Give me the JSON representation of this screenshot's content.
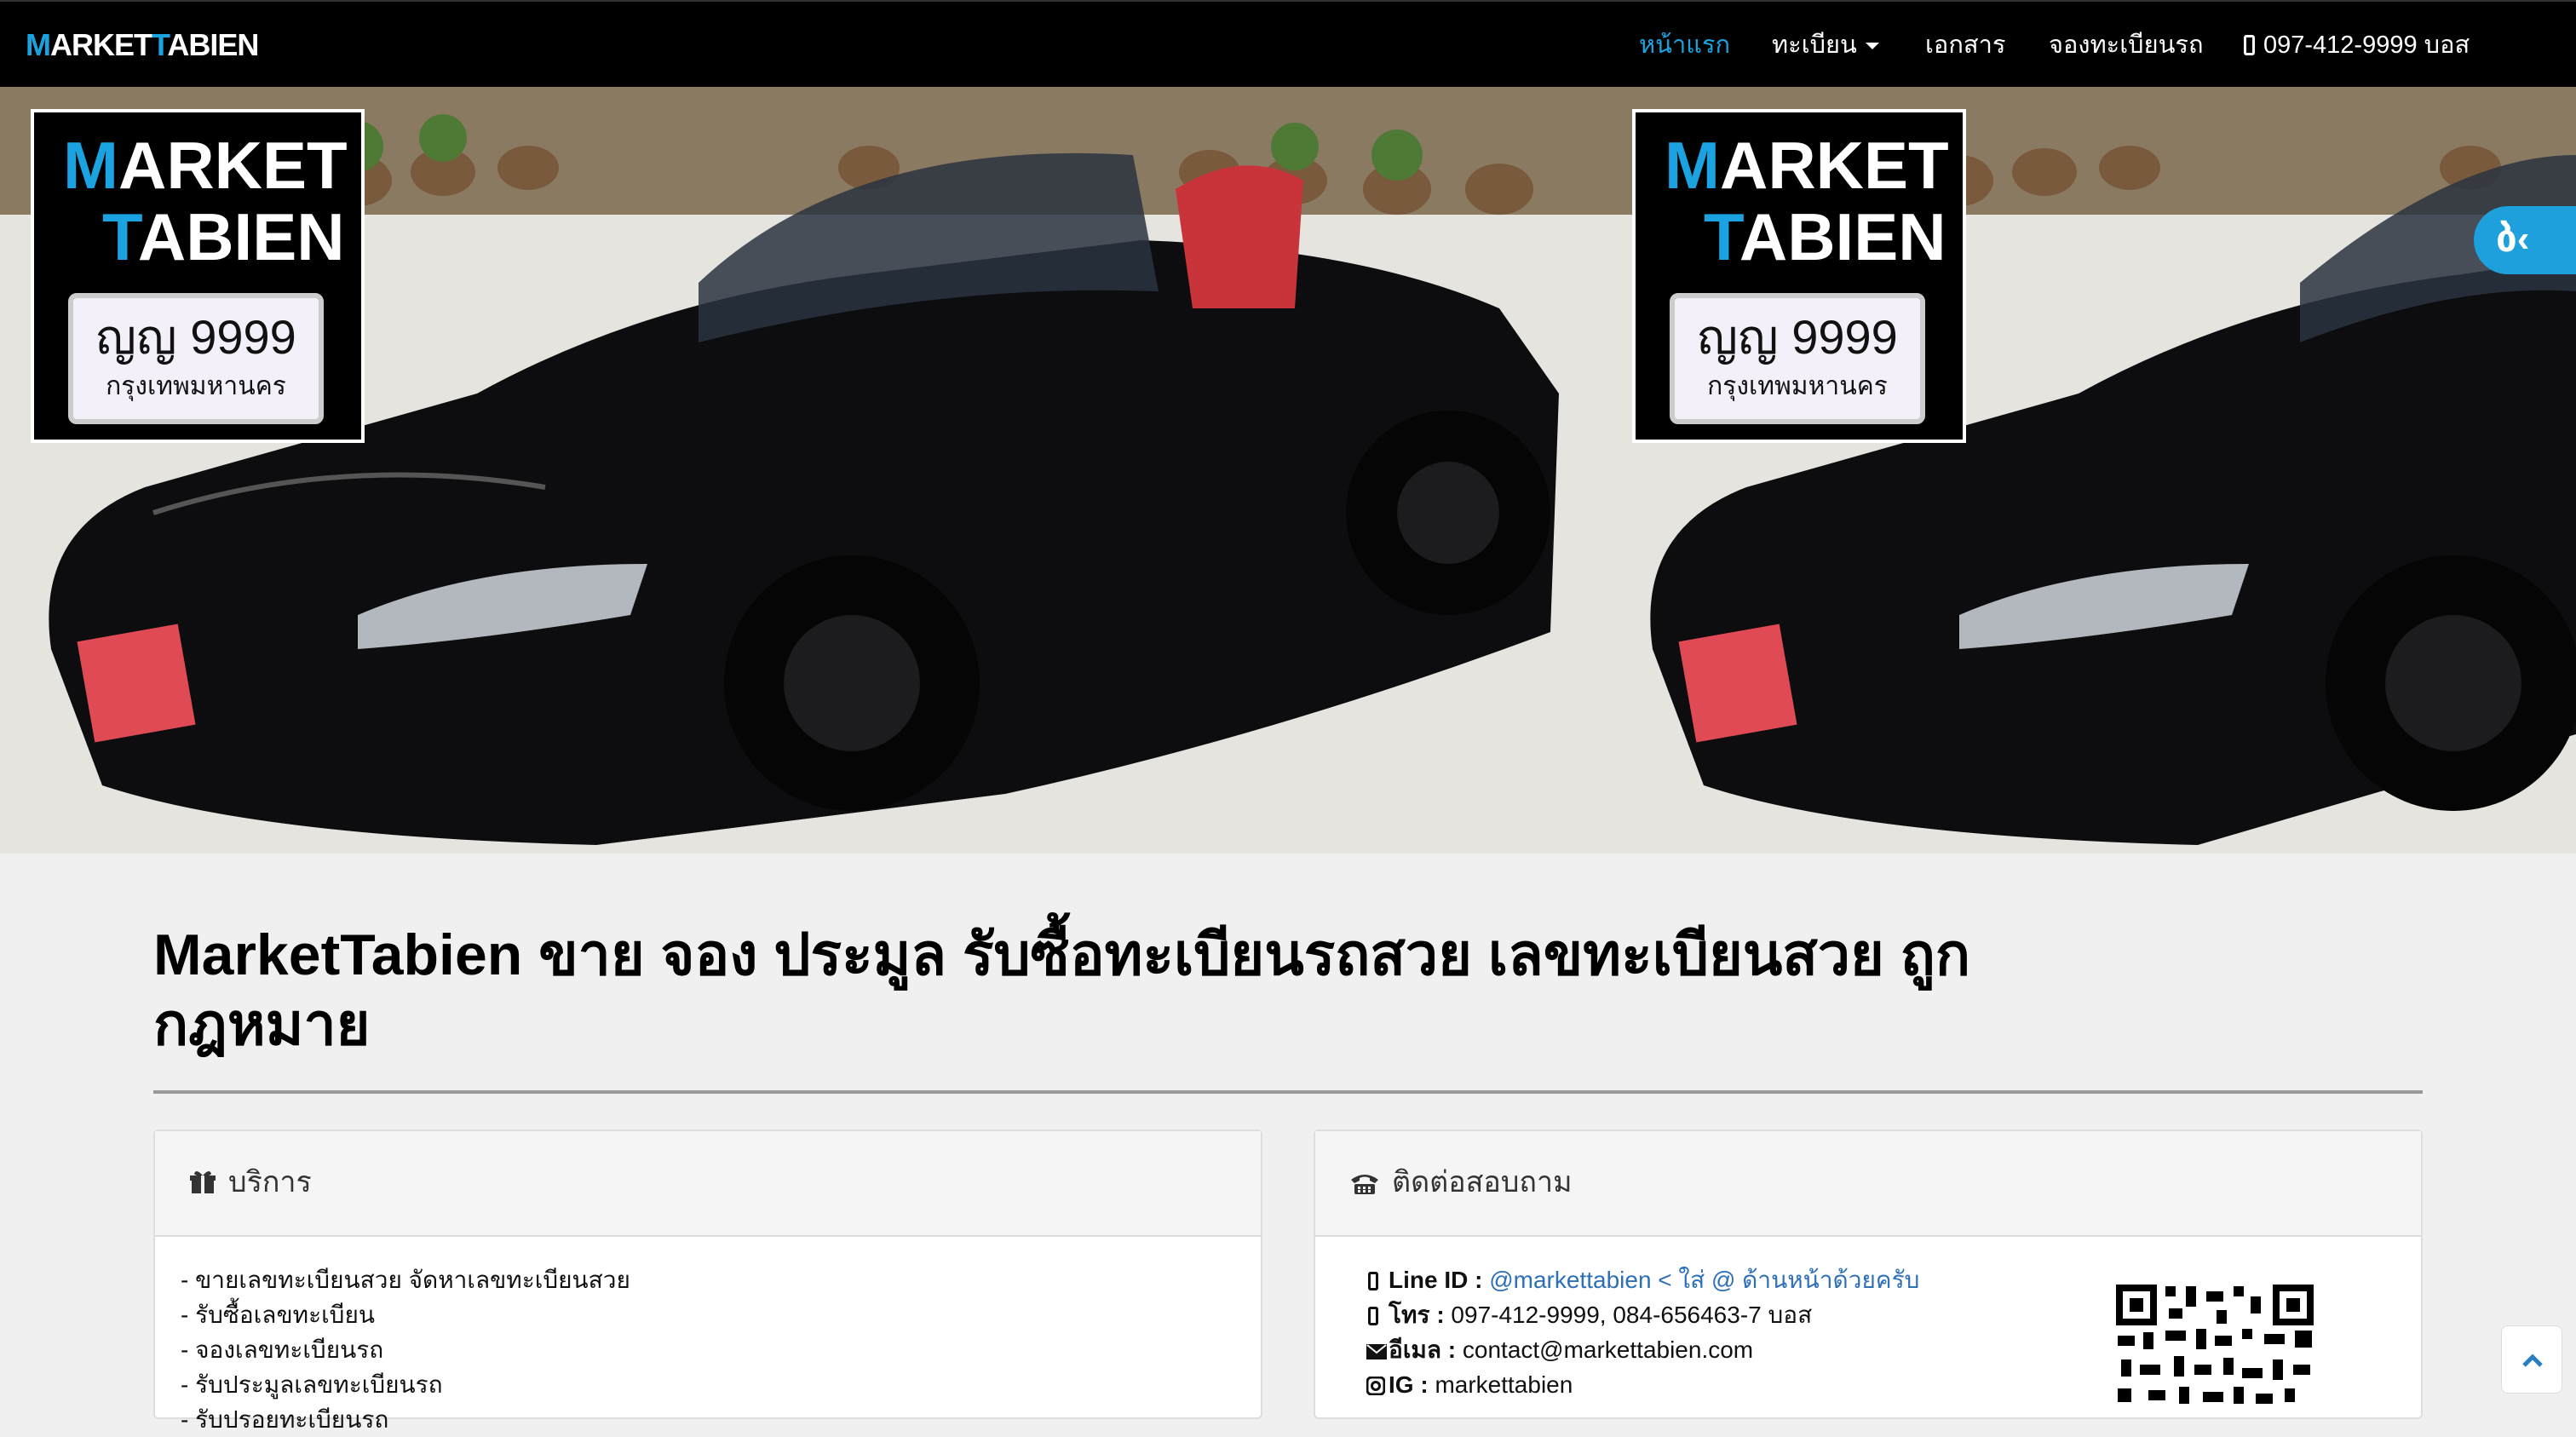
{
  "navbar": {
    "brand_m": "M",
    "brand_mid": "ARKET",
    "brand_t": "T",
    "brand_end": "ABIEN",
    "items": [
      {
        "label": "หน้าแรก",
        "active": true
      },
      {
        "label": "ทะเบียน",
        "dropdown": true
      },
      {
        "label": "เอกสาร"
      },
      {
        "label": "จองทะเบียนรถ"
      }
    ],
    "phone": "097-412-9999 บอส",
    "phone_icon": "mobile-phone-icon",
    "accent_color": "#1aa3e0"
  },
  "hero": {
    "logo_line1_initial": "M",
    "logo_line1_rest": "ARKET",
    "logo_line2_initial": "T",
    "logo_line2_rest": "ABIEN",
    "plate_number": "ญญ 9999",
    "plate_province": "กรุงเทพมหานคร",
    "side_tab_label": "ბ‹",
    "side_tab_color": "#1ea0dc"
  },
  "main": {
    "headline": "MarketTabien ขาย จอง ประมูล รับซื้อทะเบียนรถสวย เลขทะเบียนสวย ถูกกฎหมาย"
  },
  "services": {
    "title": "บริการ",
    "icon": "gift-icon",
    "items": [
      "- ขายเลขทะเบียนสวย จัดหาเลขทะเบียนสวย",
      "- รับซื้อเลขทะเบียน",
      "- จองเลขทะเบียนรถ",
      "- รับประมูลเลขทะเบียนรถ",
      "- รับปรอยทะเบียนรถ"
    ]
  },
  "contact": {
    "title": "ติดต่อสอบถาม",
    "icon": "phone-alt-icon",
    "line_label": "Line ID :",
    "line_value": "@markettabien < ใส่ @ ด้านหน้าด้วยครับ",
    "tel_label": "โทร :",
    "tel_value": "097-412-9999, 084-656463-7 บอส",
    "email_label": "อีเมล :",
    "email_value": "contact@markettabien.com",
    "ig_label": "IG :",
    "ig_value": "markettabien",
    "link_color": "#2d6fb8"
  },
  "back_to_top_icon": "chevron-up-icon"
}
